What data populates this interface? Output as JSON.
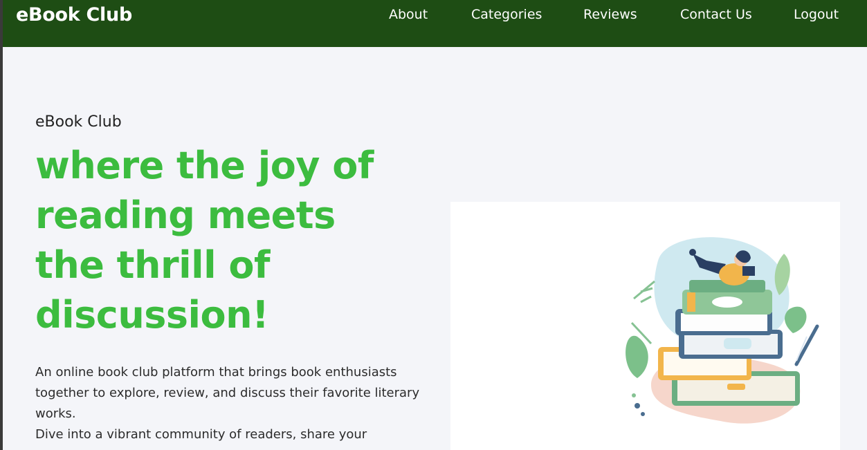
{
  "navbar": {
    "brand": "eBook Club",
    "links": [
      "About",
      "Categories",
      "Reviews",
      "Contact Us",
      "Logout"
    ],
    "background": "#1e4d14"
  },
  "hero": {
    "eyebrow": "eBook Club",
    "headline_lines": [
      "where the joy of",
      "reading meets",
      "the thrill of",
      "discussion!"
    ],
    "headline_color": "#3cbc3f",
    "description_lines": [
      "An online book club platform that brings book enthusiasts",
      "together to explore, review, and discuss their favorite literary",
      "works.",
      "Dive into a vibrant community of readers, share your"
    ]
  },
  "illustration": {
    "icon": "books-stack-reader-illustration"
  }
}
